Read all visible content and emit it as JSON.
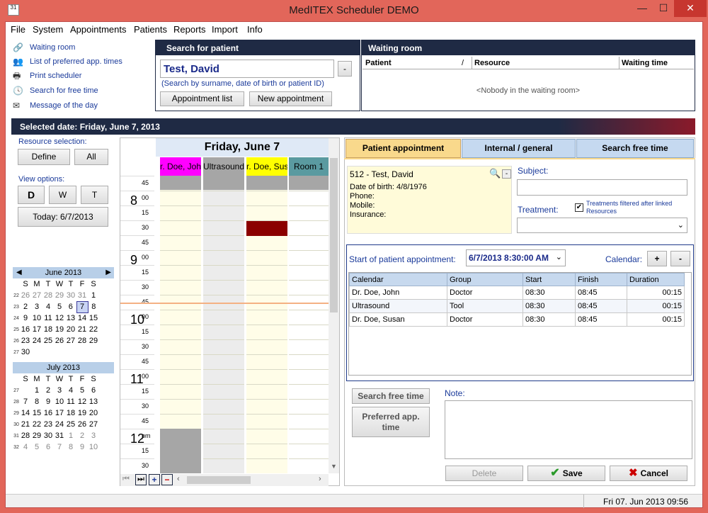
{
  "window": {
    "title": "MedITEX  Scheduler DEMO",
    "minimize": "—",
    "maximize": "☐",
    "close": "✕"
  },
  "menu": [
    "File",
    "System",
    "Appointments",
    "Patients",
    "Reports",
    "Import",
    "Info"
  ],
  "nav": [
    {
      "label": "Waiting room",
      "icon": "waiting-room-icon"
    },
    {
      "label": "List of preferred app. times",
      "icon": "person-list-icon"
    },
    {
      "label": "Print scheduler",
      "icon": "printer-icon"
    },
    {
      "label": "Search for free time",
      "icon": "search-time-icon"
    },
    {
      "label": "Message of the day",
      "icon": "message-icon"
    }
  ],
  "search": {
    "header": "Search for patient",
    "value": "Test, David",
    "hint": "(Search by surname, date of birth or patient ID)",
    "clear_btn": "-",
    "appointment_list": "Appointment list",
    "new_appointment": "New appointment"
  },
  "waiting": {
    "header": "Waiting room",
    "col_patient": "Patient",
    "col_sort": "/",
    "col_resource": "Resource",
    "col_wait": "Waiting time",
    "empty": "<Nobody in the waiting room>"
  },
  "selected_date": "Selected date: Friday, June 7, 2013",
  "left": {
    "resource_label": "Resource selection:",
    "define": "Define",
    "all": "All",
    "view_label": "View options:",
    "view_d": "D",
    "view_w": "W",
    "view_t": "T",
    "today": "Today: 6/7/2013"
  },
  "calendars": [
    {
      "month": "June 2013",
      "dow": [
        "S",
        "M",
        "T",
        "W",
        "T",
        "F",
        "S"
      ],
      "weeks": [
        {
          "wk": "22",
          "days": [
            "26",
            "27",
            "28",
            "29",
            "30",
            "31",
            "1"
          ],
          "dim": [
            0,
            1,
            2,
            3,
            4,
            5
          ]
        },
        {
          "wk": "23",
          "days": [
            "2",
            "3",
            "4",
            "5",
            "6",
            "7",
            "8"
          ],
          "dim": [],
          "sel": 5
        },
        {
          "wk": "24",
          "days": [
            "9",
            "10",
            "11",
            "12",
            "13",
            "14",
            "15"
          ],
          "dim": []
        },
        {
          "wk": "25",
          "days": [
            "16",
            "17",
            "18",
            "19",
            "20",
            "21",
            "22"
          ],
          "dim": []
        },
        {
          "wk": "26",
          "days": [
            "23",
            "24",
            "25",
            "26",
            "27",
            "28",
            "29"
          ],
          "dim": []
        },
        {
          "wk": "27",
          "days": [
            "30",
            "",
            "",
            "",
            "",
            "",
            ""
          ],
          "dim": []
        }
      ]
    },
    {
      "month": "July 2013",
      "dow": [
        "S",
        "M",
        "T",
        "W",
        "T",
        "F",
        "S"
      ],
      "weeks": [
        {
          "wk": "27",
          "days": [
            "",
            "1",
            "2",
            "3",
            "4",
            "5",
            "6"
          ],
          "dim": []
        },
        {
          "wk": "28",
          "days": [
            "7",
            "8",
            "9",
            "10",
            "11",
            "12",
            "13"
          ],
          "dim": []
        },
        {
          "wk": "29",
          "days": [
            "14",
            "15",
            "16",
            "17",
            "18",
            "19",
            "20"
          ],
          "dim": []
        },
        {
          "wk": "30",
          "days": [
            "21",
            "22",
            "23",
            "24",
            "25",
            "26",
            "27"
          ],
          "dim": []
        },
        {
          "wk": "31",
          "days": [
            "28",
            "29",
            "30",
            "31",
            "1",
            "2",
            "3"
          ],
          "dim": [
            4,
            5,
            6
          ]
        },
        {
          "wk": "32",
          "days": [
            "4",
            "5",
            "6",
            "7",
            "8",
            "9",
            "10"
          ],
          "dim": [
            0,
            1,
            2,
            3,
            4,
            5,
            6
          ]
        }
      ]
    }
  ],
  "day": {
    "title": "Friday, June 7",
    "resources": [
      {
        "label": "r. Doe, John",
        "color": "#ff00ff"
      },
      {
        "label": "Ultrasound",
        "color": "#a6a6a6"
      },
      {
        "label": "r. Doe, Susa",
        "color": "#ffff00"
      },
      {
        "label": "Room 1",
        "color": "#5a9aa0"
      }
    ],
    "time_rows": [
      {
        "hour": "",
        "min": "45"
      },
      {
        "hour": "8",
        "min": "00"
      },
      {
        "hour": "",
        "min": "15"
      },
      {
        "hour": "",
        "min": "30"
      },
      {
        "hour": "",
        "min": "45"
      },
      {
        "hour": "9",
        "min": "00"
      },
      {
        "hour": "",
        "min": "15"
      },
      {
        "hour": "",
        "min": "30"
      },
      {
        "hour": "",
        "min": "45"
      },
      {
        "hour": "10",
        "min": "00"
      },
      {
        "hour": "",
        "min": "15"
      },
      {
        "hour": "",
        "min": "30"
      },
      {
        "hour": "",
        "min": "45"
      },
      {
        "hour": "11",
        "min": "00"
      },
      {
        "hour": "",
        "min": "15"
      },
      {
        "hour": "",
        "min": "30"
      },
      {
        "hour": "",
        "min": "45"
      },
      {
        "hour": "12",
        "min": "pm"
      },
      {
        "hour": "",
        "min": "15"
      },
      {
        "hour": "",
        "min": "30"
      }
    ],
    "booked_color": "#8b0000"
  },
  "tabs": [
    "Patient appointment",
    "Internal / general",
    "Search free time"
  ],
  "patient": {
    "id_name": "512 - Test, David",
    "dob_label": "Date of birth:",
    "dob": "4/8/1976",
    "phone": "Phone:",
    "mobile": "Mobile:",
    "insurance": "Insurance:",
    "minus": "-"
  },
  "subject_label": "Subject:",
  "treatment_label": "Treatment:",
  "treatment_filter": "Treatments filtered after linked Resources",
  "start_label": "Start of patient appointment:",
  "start_value": "6/7/2013 8:30:00 AM",
  "calendar_label": "Calendar:",
  "cal_plus": "+",
  "cal_minus": "-",
  "appt_table": {
    "headers": [
      "Calendar",
      "Group",
      "Start",
      "Finish",
      "Duration"
    ],
    "rows": [
      [
        "Dr. Doe, John",
        "Doctor",
        "08:30",
        "08:45",
        "00:15"
      ],
      [
        "Ultrasound",
        "Tool",
        "08:30",
        "08:45",
        "00:15"
      ],
      [
        "Dr. Doe, Susan",
        "Doctor",
        "08:30",
        "08:45",
        "00:15"
      ]
    ]
  },
  "search_free_time_btn": "Search free time",
  "preferred_btn": "Preferred app. time",
  "note_label": "Note:",
  "delete": "Delete",
  "save": "Save",
  "cancel": "Cancel",
  "status_time": "Fri 07. Jun 2013 09:56",
  "colors": {
    "accent": "#1f2a44",
    "tab_active": "#f9d98c",
    "tab_inactive": "#c5d9f0",
    "note_bg": "#fffbd9"
  }
}
